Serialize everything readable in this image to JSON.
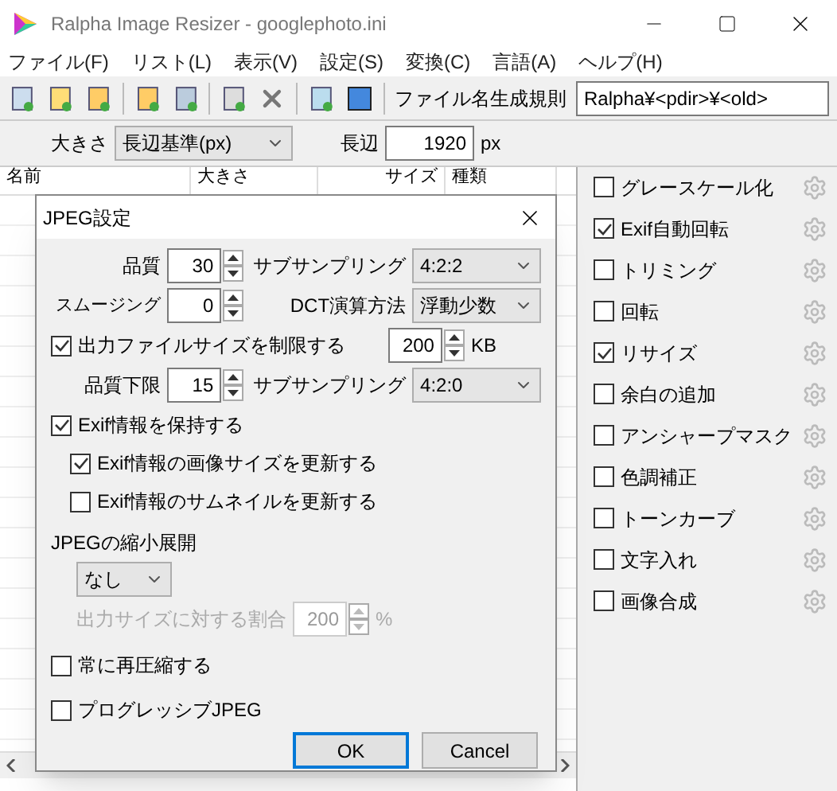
{
  "window": {
    "title": "Ralpha Image Resizer - googlephoto.ini"
  },
  "menu": [
    "ファイル(F)",
    "リスト(L)",
    "表示(V)",
    "設定(S)",
    "変換(C)",
    "言語(A)",
    "ヘルプ(H)"
  ],
  "toolbar": {
    "rule_label": "ファイル名生成規則",
    "rule_value": "Ralpha¥<pdir>¥<old>"
  },
  "size_row": {
    "size_label": "大きさ",
    "size_mode": "長辺基準(px)",
    "edge_label": "長辺",
    "edge_value": "1920",
    "unit": "px"
  },
  "file_list": {
    "columns": [
      "名前",
      "大きさ",
      "サイズ",
      "種類"
    ]
  },
  "filters": [
    {
      "label": "グレースケール化",
      "checked": false
    },
    {
      "label": "Exif自動回転",
      "checked": true
    },
    {
      "label": "トリミング",
      "checked": false
    },
    {
      "label": "回転",
      "checked": false
    },
    {
      "label": "リサイズ",
      "checked": true
    },
    {
      "label": "余白の追加",
      "checked": false
    },
    {
      "label": "アンシャープマスク",
      "checked": false
    },
    {
      "label": "色調補正",
      "checked": false
    },
    {
      "label": "トーンカーブ",
      "checked": false
    },
    {
      "label": "文字入れ",
      "checked": false
    },
    {
      "label": "画像合成",
      "checked": false
    }
  ],
  "dialog": {
    "title": "JPEG設定",
    "quality_label": "品質",
    "quality": "30",
    "subsampling_label": "サブサンプリング",
    "subsampling": "4:2:2",
    "smoothing_label": "スムージング",
    "smoothing": "0",
    "dct_label": "DCT演算方法",
    "dct": "浮動少数",
    "limit": {
      "label": "出力ファイルサイズを制限する",
      "checked": true,
      "value": "200",
      "unit": "KB"
    },
    "min_quality_label": "品質下限",
    "min_quality": "15",
    "subsampling2_label": "サブサンプリング",
    "subsampling2": "4:2:0",
    "exif": {
      "label": "Exif情報を保持する",
      "checked": true
    },
    "exif_size": {
      "label": "Exif情報の画像サイズを更新する",
      "checked": true
    },
    "exif_thumb": {
      "label": "Exif情報のサムネイルを更新する",
      "checked": false
    },
    "scale_heading": "JPEGの縮小展開",
    "scale_mode": "なし",
    "ratio": {
      "label": "出力サイズに対する割合",
      "value": "200",
      "unit": "%",
      "disabled": true
    },
    "recompress": {
      "label": "常に再圧縮する",
      "checked": false
    },
    "progressive": {
      "label": "プログレッシブJPEG",
      "checked": false
    },
    "buttons": [
      "OK",
      "Cancel"
    ]
  }
}
